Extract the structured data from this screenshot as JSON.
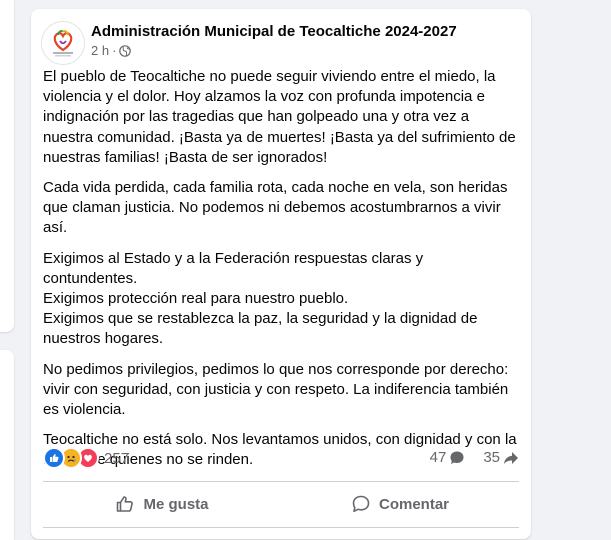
{
  "post": {
    "page_name": "Administración Municipal de Teocaltiche 2024-2027",
    "timestamp": "2 h",
    "separator": "·",
    "avatar_text": "TEOCALTICHE",
    "paragraphs": [
      "El pueblo de Teocaltiche no puede seguir viviendo entre el miedo, la violencia y el dolor. Hoy alzamos la voz con profunda impotencia e indignación por las tragedias que han golpeado una y otra vez a nuestra comunidad. ¡Basta ya de muertes! ¡Basta ya del sufrimiento de nuestras familias! ¡Basta de ser ignorados!",
      "Cada vida perdida, cada familia rota, cada noche en vela, son heridas que claman justicia. No podemos ni debemos acostumbrarnos a vivir así.",
      "Exigimos al Estado y a la Federación respuestas claras y contundentes.\nExigimos protección real para nuestro pueblo.\nExigimos que se restablezca la paz, la seguridad y la dignidad de nuestros hogares.",
      "No pedimos privilegios, pedimos lo que nos corresponde por derecho: vivir con seguridad, con justicia y con respeto. La indiferencia también es violencia.",
      "Teocaltiche no está solo. Nos levantamos unidos, con dignidad y con la fuerza de quienes no se rinden."
    ],
    "reactions": {
      "icons": [
        "like-icon",
        "sad-icon",
        "love-icon"
      ],
      "count": "257"
    },
    "comments_count": "47",
    "shares_count": "35",
    "actions": {
      "like_label": "Me gusta",
      "comment_label": "Comentar"
    }
  },
  "colors": {
    "like": "#1b74e4",
    "sad": "#f7b125",
    "love": "#f33e58",
    "secondary_text": "#65676b"
  }
}
